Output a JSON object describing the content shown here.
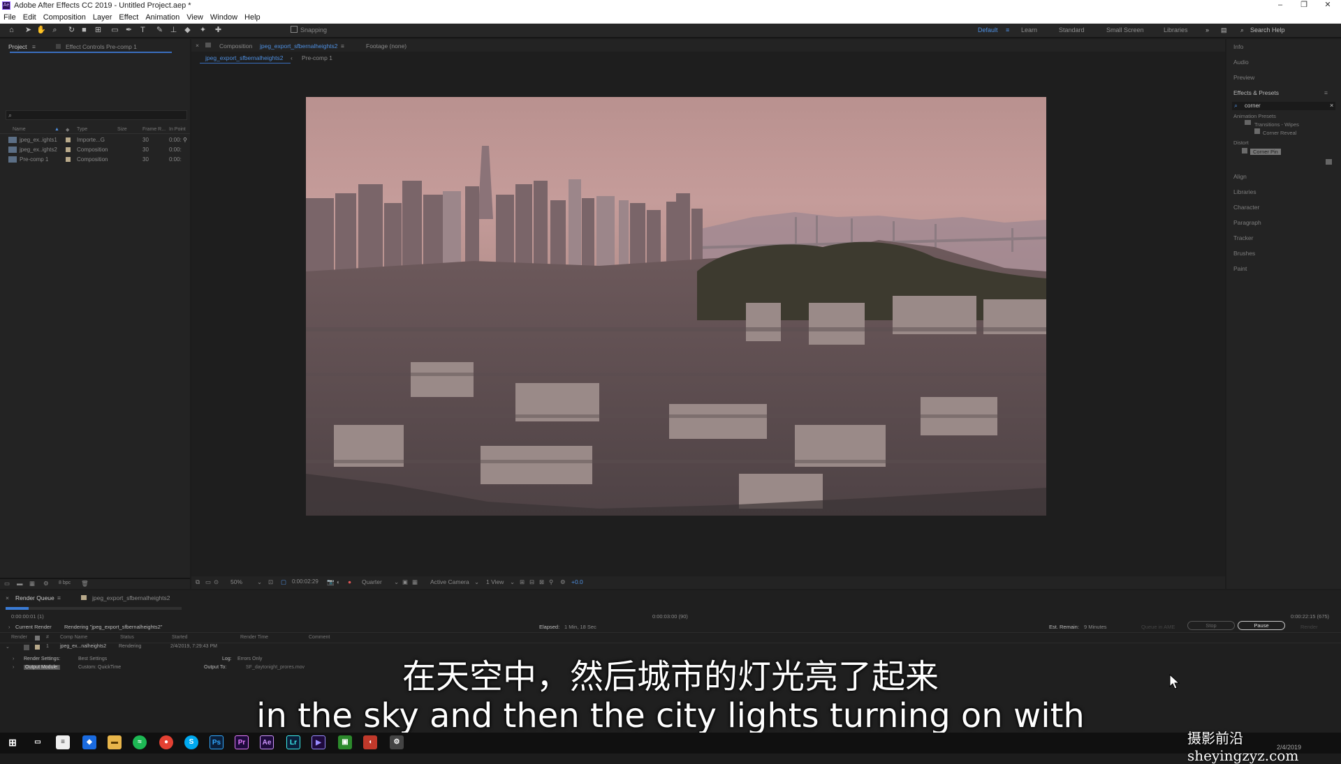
{
  "window": {
    "title": "Adobe After Effects CC 2019 - Untitled Project.aep *",
    "minimize": "–",
    "maximize": "❐",
    "close": "✕"
  },
  "menu": [
    "File",
    "Edit",
    "Composition",
    "Layer",
    "Effect",
    "Animation",
    "View",
    "Window",
    "Help"
  ],
  "toolbar": {
    "snapping": "Snapping",
    "workspaces": [
      "Default",
      "Learn",
      "Standard",
      "Small Screen",
      "Libraries"
    ],
    "search_help": "Search Help"
  },
  "project": {
    "tab": "Project",
    "effect_controls": "Effect Controls Pre-comp 1",
    "columns": [
      "Name",
      "Type",
      "Size",
      "Frame R...",
      "In Point"
    ],
    "items": [
      {
        "name": "jpeg_ex..ights1",
        "type": "Importe...G",
        "fps": "30",
        "in": "0:00:"
      },
      {
        "name": "jpeg_ex..ights2",
        "type": "Composition",
        "fps": "30",
        "in": "0:00:"
      },
      {
        "name": "Pre-comp 1",
        "type": "Composition",
        "fps": "30",
        "in": "0:00:"
      }
    ],
    "bpc": "8 bpc"
  },
  "comp": {
    "tab_prefix": "Composition",
    "tab_name": "jpeg_export_sfbernalheights2",
    "footage": "Footage (none)",
    "subtabs": [
      "jpeg_export_sfbernalheights2",
      "Pre-comp 1"
    ],
    "zoom": "50%",
    "timecode": "0:00:02:29",
    "resolution": "Quarter",
    "camera": "Active Camera",
    "views": "1 View",
    "exposure": "+0.0"
  },
  "effects": {
    "side_top": [
      "Info",
      "Audio",
      "Preview"
    ],
    "title": "Effects & Presets",
    "search": "corner",
    "tree": [
      "Animation Presets",
      "Transitions - Wipes",
      "Corner Reveal",
      "Distort",
      "Corner Pin"
    ],
    "side_bottom": [
      "Align",
      "Libraries",
      "Character",
      "Paragraph",
      "Tracker",
      "Brushes",
      "Paint"
    ]
  },
  "render": {
    "tab": "Render Queue",
    "comp_tab": "jpeg_export_sfbernalheights2",
    "progress": 0.13,
    "start_time": "0:00:00:01 (1)",
    "mid_time": "0:00:03:00 (90)",
    "end_time": "0:00:22:15 (675)",
    "current_render": "Current Render",
    "rendering": "Rendering \"jpeg_export_sfbernalheights2\"",
    "elapsed_label": "Elapsed:",
    "elapsed": "1 Min, 18 Sec",
    "remain_label": "Est. Remain:",
    "remain": "9 Minutes",
    "queue_ame": "Queue in AME",
    "stop": "Stop",
    "pause": "Pause",
    "render_btn": "Render",
    "columns": [
      "Render",
      "#",
      "Comp Name",
      "Status",
      "Started",
      "Render Time",
      "Comment"
    ],
    "item": {
      "num": "1",
      "comp": "jpeg_ex...nalheights2",
      "status": "Rendering",
      "started": "2/4/2019, 7:29:43 PM"
    },
    "render_settings_label": "Render Settings:",
    "render_settings": "Best Settings",
    "log_label": "Log:",
    "log": "Errors Only",
    "output_module_label": "Output Module:",
    "output_module": "Custom: QuickTime",
    "output_to_label": "Output To:",
    "output_to": "SF_daytonight_prores.mov"
  },
  "subtitles": {
    "zh": "在天空中，然后城市的灯光亮了起来",
    "en": "in the sky and then the city lights turning on with"
  },
  "watermark": "摄影前沿 sheyingzyz.com",
  "taskbar": {
    "date": "2/4/2019"
  }
}
